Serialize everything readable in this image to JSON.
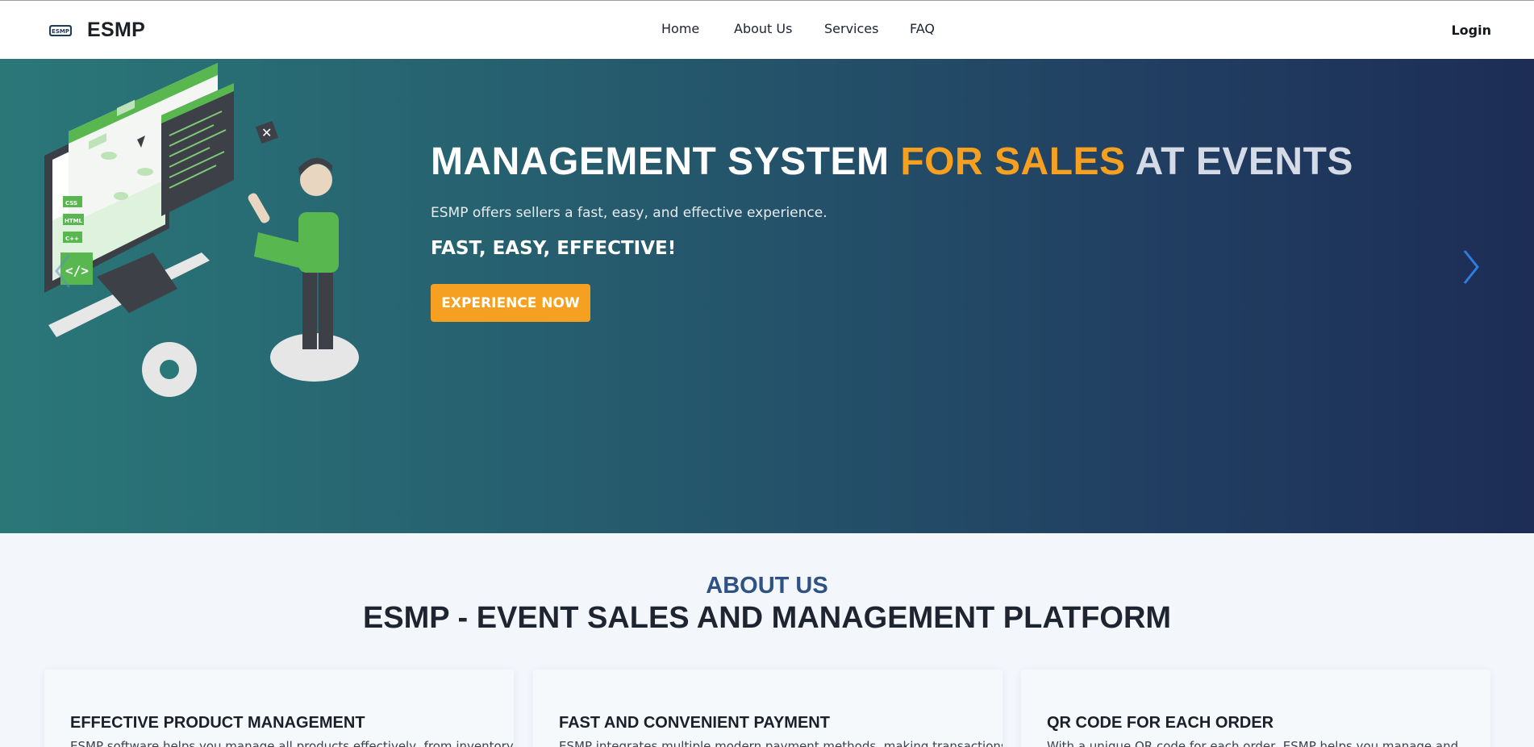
{
  "header": {
    "brand": "ESMP",
    "logo_text": "ESMP",
    "nav": {
      "home": "Home",
      "about": "About Us",
      "services": "Services",
      "faq": "FAQ"
    },
    "login": "Login"
  },
  "hero": {
    "title_part1": "MANAGEMENT SYSTEM",
    "title_part2": "FOR SALES",
    "title_part3": "AT EVENTS",
    "subtitle": "ESMP offers sellers a fast, easy, and effective experience.",
    "tagline": "FAST, EASY, EFFECTIVE!",
    "cta": "EXPERIENCE NOW",
    "illustration_labels": [
      "CSS",
      "HTML",
      "C++"
    ],
    "prev_icon": "chevron-left-icon",
    "next_icon": "chevron-right-icon",
    "colors": {
      "accent": "#f6a021",
      "gradient_start": "#2a7778",
      "gradient_end": "#1d2d55",
      "chevron": "#2f7de1"
    }
  },
  "about": {
    "eyebrow": "ABOUT US",
    "title": "ESMP - EVENT SALES AND MANAGEMENT PLATFORM",
    "cards": [
      {
        "title": "EFFECTIVE PRODUCT MANAGEMENT",
        "text": "ESMP software helps you manage all products effectively, from inventory"
      },
      {
        "title": "FAST AND CONVENIENT PAYMENT",
        "text": "ESMP integrates multiple modern payment methods, making transactions"
      },
      {
        "title": "QR CODE FOR EACH ORDER",
        "text": "With a unique QR code for each order, ESMP helps you manage and"
      }
    ]
  }
}
